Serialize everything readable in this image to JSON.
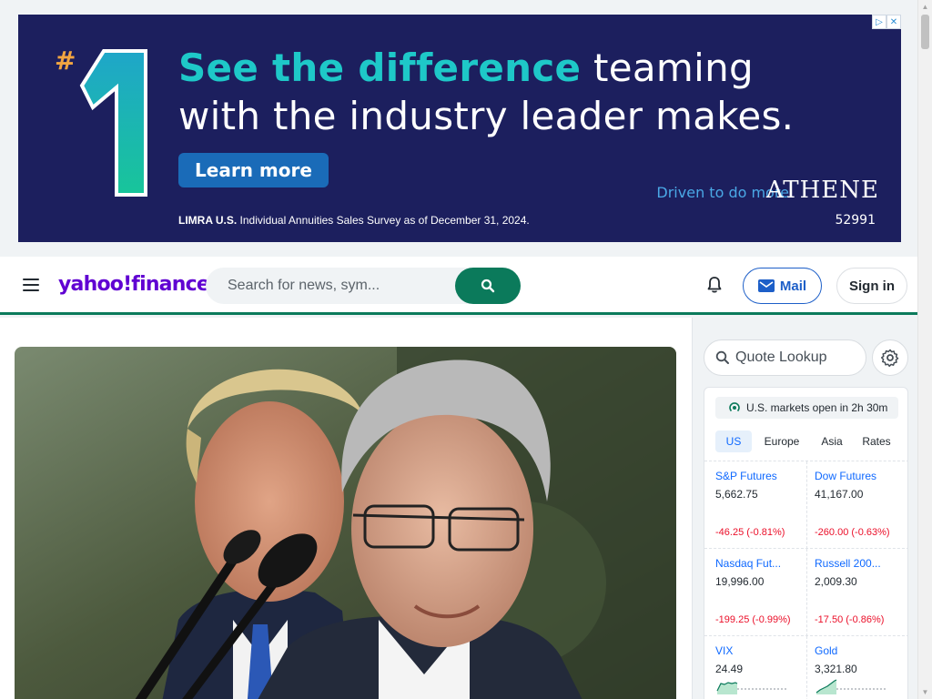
{
  "ad": {
    "hash": "#",
    "headline_accent": "See the difference",
    "headline_rest": " teaming with the industry leader makes.",
    "cta": "Learn more",
    "tagline": "Driven to do more.",
    "brand": "ATHENE",
    "disclaimer_bold": "LIMRA U.S.",
    "disclaimer_rest": " Individual Annuities Sales Survey as of December 31, 2024.",
    "code": "52991",
    "colors": {
      "background": "#1c1f5e",
      "accent": "#1ec8c8",
      "cta": "#1a6bb8"
    }
  },
  "header": {
    "logo": "yahoo!finance",
    "search_placeholder": "Search for news, sym...",
    "mail_label": "Mail",
    "signin_label": "Sign in",
    "accent_color": "#0b7a5b"
  },
  "rail": {
    "quote_placeholder": "Quote Lookup",
    "market_status": "U.S. markets open in 2h 30m",
    "tabs": [
      {
        "label": "US",
        "active": true
      },
      {
        "label": "Europe",
        "active": false
      },
      {
        "label": "Asia",
        "active": false
      },
      {
        "label": "Rates",
        "active": false
      }
    ],
    "tiles": [
      {
        "name": "S&P Futures",
        "price": "5,662.75",
        "change": "-46.25 (-0.81%)"
      },
      {
        "name": "Dow Futures",
        "price": "41,167.00",
        "change": "-260.00 (-0.63%)"
      },
      {
        "name": "Nasdaq Fut...",
        "price": "19,996.00",
        "change": "-199.25 (-0.99%)"
      },
      {
        "name": "Russell 200...",
        "price": "2,009.30",
        "change": "-17.50 (-0.86%)"
      },
      {
        "name": "VIX",
        "price": "24.49",
        "change": ""
      },
      {
        "name": "Gold",
        "price": "3,321.80",
        "change": ""
      }
    ]
  }
}
